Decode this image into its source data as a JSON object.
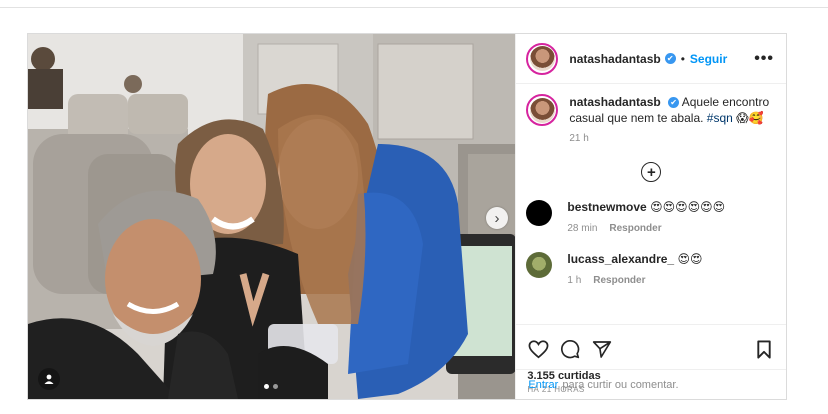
{
  "post": {
    "username": "natashadantasb",
    "verified_symbol": "✔",
    "separator": "•",
    "follow_label": "Seguir",
    "more_label": "•••",
    "caption": {
      "username": "natashadantasb",
      "text": "Aquele encontro casual que nem te abala.",
      "hashtag": "#sqn",
      "emoji": "😱🥰",
      "time": "21 h"
    },
    "add_comment_symbol": "+",
    "comments": [
      {
        "username": "bestnewmove",
        "text": "😍😍😍😍😍😍",
        "time": "28 min",
        "reply_label": "Responder",
        "avatar_color": "#000000"
      },
      {
        "username": "lucass_alexandre_",
        "text": "😍😍",
        "time": "1 h",
        "reply_label": "Responder",
        "avatar_color": "#6b7a45"
      }
    ],
    "likes": "3.155 curtidas",
    "posted_ago": "HÁ 21 HORAS",
    "enter_label": "Entrar",
    "enter_prompt": "para curtir ou comentar.",
    "next_symbol": "›",
    "carousel": {
      "count": 2,
      "active": 0
    }
  }
}
